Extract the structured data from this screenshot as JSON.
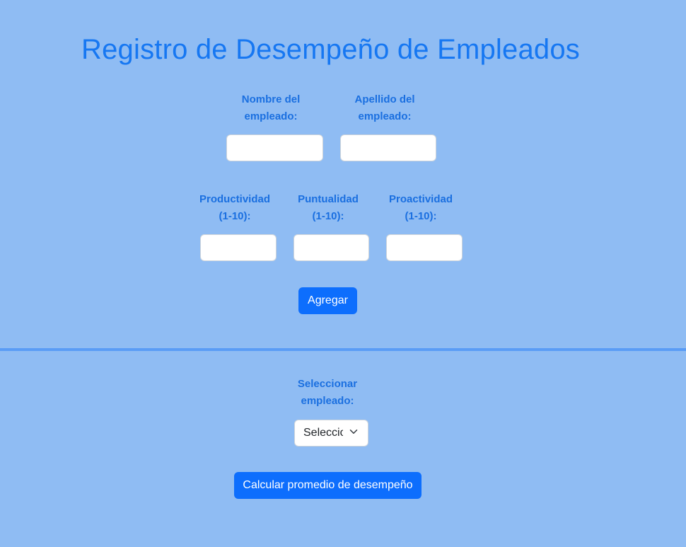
{
  "header": {
    "title": "Registro de Desempeño de Empleados"
  },
  "form": {
    "first_name": {
      "label": "Nombre del empleado:",
      "value": ""
    },
    "last_name": {
      "label": "Apellido del empleado:",
      "value": ""
    },
    "productivity": {
      "label": "Productividad (1-10):",
      "value": ""
    },
    "punctuality": {
      "label": "Puntualidad (1-10):",
      "value": ""
    },
    "proactivity": {
      "label": "Proactividad (1-10):",
      "value": ""
    },
    "add_button": "Agregar"
  },
  "selection": {
    "label": "Seleccionar empleado:",
    "selected": "Seleccionar",
    "calculate_button": "Calcular promedio de desempeño"
  },
  "icons": {
    "select_arrow": "chevron-down-icon"
  },
  "colors": {
    "background": "#8fbcf3",
    "accent": "#0d6efd",
    "title": "#1677f2",
    "label": "#1a6fe0",
    "divider": "#5a9cf5"
  }
}
